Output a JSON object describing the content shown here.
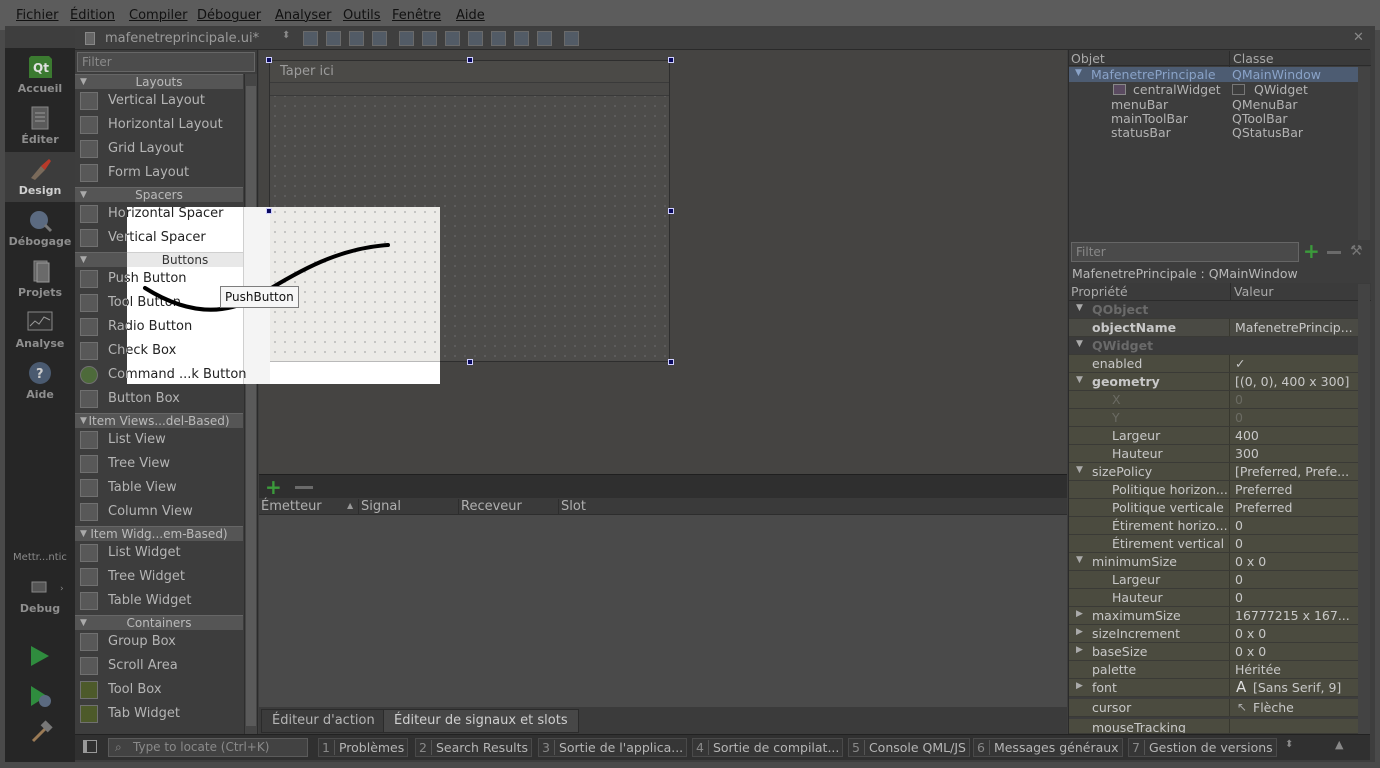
{
  "menu": [
    "Fichier",
    "Édition",
    "Compiler",
    "Déboguer",
    "Analyser",
    "Outils",
    "Fenêtre",
    "Aide"
  ],
  "modes": [
    "Accueil",
    "Éditer",
    "Design",
    "Débogage",
    "Projets",
    "Analyse",
    "Aide"
  ],
  "kit": {
    "label": "Mettr...ntic",
    "debug_label": "Debug"
  },
  "editor": {
    "filename": "mafenetreprincipale.ui*"
  },
  "widget_box": {
    "filter_placeholder": "Filter",
    "categories": {
      "layouts": "Layouts",
      "spacers": "Spacers",
      "buttons": "Buttons",
      "item_views": "Item Views...del-Based)",
      "item_widgets": "Item Widg...em-Based)",
      "containers": "Containers"
    },
    "items": {
      "vertical_layout": "Vertical Layout",
      "horizontal_layout": "Horizontal Layout",
      "grid_layout": "Grid Layout",
      "form_layout": "Form Layout",
      "horizontal_spacer": "Horizontal Spacer",
      "vertical_spacer": "Vertical Spacer",
      "push_button": "Push Button",
      "tool_button": "Tool Button",
      "radio_button": "Radio Button",
      "check_box": "Check Box",
      "command_link": "Command ...k Button",
      "button_box": "Button Box",
      "list_view": "List View",
      "tree_view": "Tree View",
      "table_view": "Table View",
      "column_view": "Column View",
      "list_widget": "List Widget",
      "tree_widget": "Tree Widget",
      "table_widget": "Table Widget",
      "group_box": "Group Box",
      "scroll_area": "Scroll Area",
      "tool_box": "Tool Box",
      "tab_widget": "Tab Widget"
    }
  },
  "form": {
    "menu_placeholder": "Taper ici",
    "drag_tooltip": "PushButton"
  },
  "signal_slot": {
    "columns": [
      "Émetteur",
      "Signal",
      "Receveur",
      "Slot"
    ],
    "tabs": [
      "Éditeur d'action",
      "Éditeur de signaux et slots"
    ]
  },
  "object_inspector": {
    "headers": [
      "Objet",
      "Classe"
    ],
    "rows": [
      {
        "obj": "MafenetrePrincipale",
        "cls": "QMainWindow"
      },
      {
        "obj": "centralWidget",
        "cls": "QWidget"
      },
      {
        "obj": "menuBar",
        "cls": "QMenuBar"
      },
      {
        "obj": "mainToolBar",
        "cls": "QToolBar"
      },
      {
        "obj": "statusBar",
        "cls": "QStatusBar"
      }
    ]
  },
  "property_editor": {
    "filter_placeholder": "Filter",
    "title": "MafenetrePrincipale : QMainWindow",
    "headers": [
      "Propriété",
      "Valeur"
    ],
    "rows": [
      {
        "k": "QObject",
        "v": ""
      },
      {
        "k": "objectName",
        "v": "MafenetrePrincip..."
      },
      {
        "k": "QWidget",
        "v": ""
      },
      {
        "k": "enabled",
        "v": "✓"
      },
      {
        "k": "geometry",
        "v": "[(0, 0), 400 x 300]"
      },
      {
        "k": "X",
        "v": "0"
      },
      {
        "k": "Y",
        "v": "0"
      },
      {
        "k": "Largeur",
        "v": "400"
      },
      {
        "k": "Hauteur",
        "v": "300"
      },
      {
        "k": "sizePolicy",
        "v": "[Preferred, Prefe..."
      },
      {
        "k": "Politique horizon...",
        "v": "Preferred"
      },
      {
        "k": "Politique verticale",
        "v": "Preferred"
      },
      {
        "k": "Étirement horizo...",
        "v": "0"
      },
      {
        "k": "Étirement vertical",
        "v": "0"
      },
      {
        "k": "minimumSize",
        "v": "0 x 0"
      },
      {
        "k": "Largeur",
        "v": "0"
      },
      {
        "k": "Hauteur",
        "v": "0"
      },
      {
        "k": "maximumSize",
        "v": "16777215 x 167..."
      },
      {
        "k": "sizeIncrement",
        "v": "0 x 0"
      },
      {
        "k": "baseSize",
        "v": "0 x 0"
      },
      {
        "k": "palette",
        "v": "Héritée"
      },
      {
        "k": "font",
        "v": "[Sans Serif, 9]"
      },
      {
        "k": "cursor",
        "v": "Flèche"
      },
      {
        "k": "mouseTracking",
        "v": ""
      }
    ]
  },
  "statusbar": {
    "locate_placeholder": "Type to locate (Ctrl+K)",
    "buttons": [
      {
        "n": "1",
        "label": "Problèmes"
      },
      {
        "n": "2",
        "label": "Search Results"
      },
      {
        "n": "3",
        "label": "Sortie de l'applica..."
      },
      {
        "n": "4",
        "label": "Sortie de compilat..."
      },
      {
        "n": "5",
        "label": "Console QML/JS"
      },
      {
        "n": "6",
        "label": "Messages généraux"
      },
      {
        "n": "7",
        "label": "Gestion de versions"
      }
    ]
  },
  "colors": {
    "accent": "#0a0a60",
    "selection": "#4d5c72",
    "run_green": "#3aa34a"
  }
}
